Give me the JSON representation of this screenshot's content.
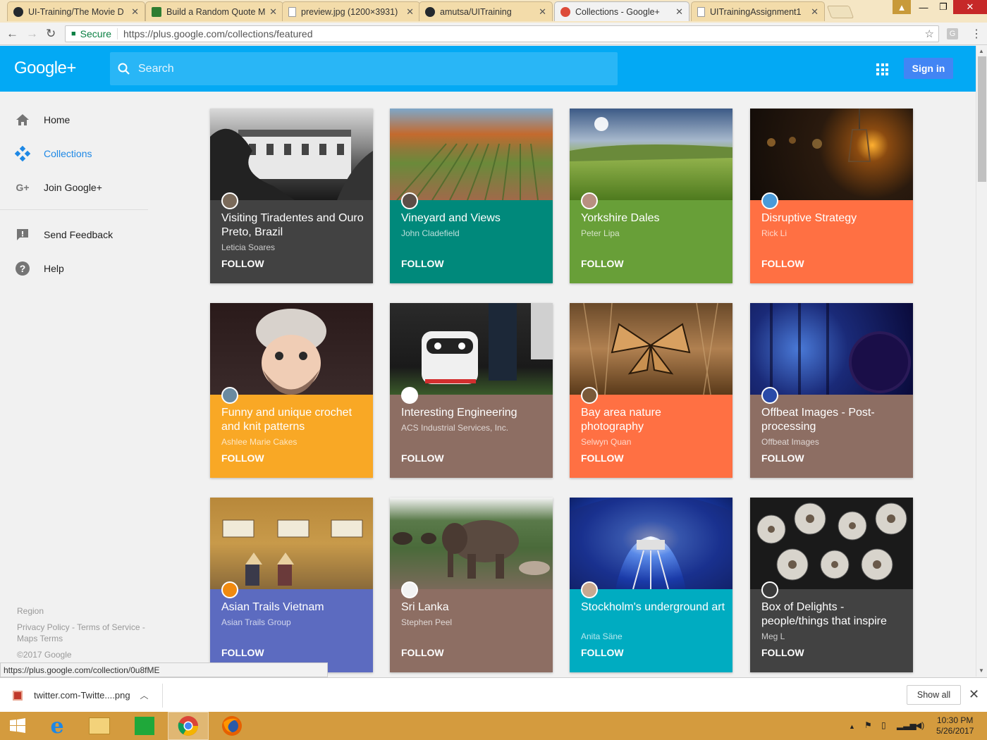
{
  "browser": {
    "tabs": [
      {
        "title": "UI-Training/The Movie D",
        "icon": "github-icon",
        "color": "#24292e"
      },
      {
        "title": "Build a Random Quote M",
        "icon": "codepen-icon",
        "color": "#2e7d32"
      },
      {
        "title": "preview.jpg (1200×3931)",
        "icon": "page-icon",
        "color": "#9e9e9e"
      },
      {
        "title": "amutsa/UITraining",
        "icon": "github-icon",
        "color": "#24292e"
      },
      {
        "title": "Collections - Google+",
        "icon": "google-plus-icon",
        "color": "#dd4b39"
      },
      {
        "title": "UITrainingAssignment1",
        "icon": "page-icon",
        "color": "#9e9e9e"
      }
    ],
    "secure_label": "Secure",
    "url": "https://plus.google.com/collections/featured",
    "status_url": "https://plus.google.com/collection/0u8fME"
  },
  "header": {
    "logo": "Google+",
    "search_placeholder": "Search",
    "signin_label": "Sign in"
  },
  "sidebar": {
    "items": [
      {
        "label": "Home",
        "icon": "home-icon"
      },
      {
        "label": "Collections",
        "icon": "collections-icon",
        "active": true
      },
      {
        "label": "Join Google+",
        "icon": "google-plus-icon"
      }
    ],
    "secondary": [
      {
        "label": "Send Feedback",
        "icon": "feedback-icon"
      },
      {
        "label": "Help",
        "icon": "help-icon"
      }
    ],
    "footer": {
      "region": "Region",
      "policy": "Privacy Policy - Terms of Service - Maps Terms",
      "copyright": "©2017 Google"
    }
  },
  "collections": [
    {
      "title": "Visiting Tiradentes and Ouro Preto, Brazil",
      "author": "Leticia Soares",
      "follow": "FOLLOW",
      "color": "#424242"
    },
    {
      "title": "Vineyard and Views",
      "author": "John Cladefield",
      "follow": "FOLLOW",
      "color": "#00897b"
    },
    {
      "title": "Yorkshire Dales",
      "author": "Peter Lipa",
      "follow": "FOLLOW",
      "color": "#689f38"
    },
    {
      "title": "Disruptive Strategy",
      "author": "Rick Li",
      "follow": "FOLLOW",
      "color": "#ff7043"
    },
    {
      "title": "Funny and unique crochet and knit patterns",
      "author": "Ashlee Marie Cakes",
      "follow": "FOLLOW",
      "color": "#f9a825"
    },
    {
      "title": "Interesting Engineering",
      "author": "ACS Industrial Services, Inc.",
      "follow": "FOLLOW",
      "color": "#8d6e63"
    },
    {
      "title": "Bay area nature photography",
      "author": "Selwyn Quan",
      "follow": "FOLLOW",
      "color": "#ff7043"
    },
    {
      "title": "Offbeat Images - Post-processing",
      "author": "Offbeat Images",
      "follow": "FOLLOW",
      "color": "#8d6e63"
    },
    {
      "title": "Asian Trails Vietnam",
      "author": "Asian Trails Group",
      "follow": "FOLLOW",
      "color": "#5c6bc0"
    },
    {
      "title": "Sri Lanka",
      "author": "Stephen Peel",
      "follow": "FOLLOW",
      "color": "#8d6e63"
    },
    {
      "title": "Stockholm's underground art",
      "author": "Anita Säne",
      "follow": "FOLLOW",
      "color": "#00acc1"
    },
    {
      "title": "Box of Delights - people/things that inspire",
      "author": "Meg L",
      "follow": "FOLLOW",
      "color": "#424242"
    }
  ],
  "downloads": {
    "file": "twitter.com-Twitte....png",
    "show_all": "Show all"
  },
  "taskbar": {
    "time": "10:30 PM",
    "date": "5/26/2017"
  }
}
